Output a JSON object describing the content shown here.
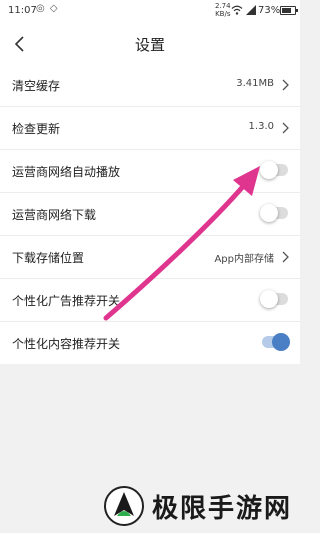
{
  "status_bar": {
    "time": "11:07",
    "net_speed": "2.74",
    "net_unit": "KB/s",
    "battery": "73%",
    "battery_level": 0.73
  },
  "header": {
    "title": "设置"
  },
  "settings": {
    "clear_cache": {
      "label": "清空缓存",
      "value": "3.41MB"
    },
    "check_update": {
      "label": "检查更新",
      "value": "1.3.0"
    },
    "carrier_autoplay": {
      "label": "运营商网络自动播放",
      "enabled": false
    },
    "carrier_download": {
      "label": "运营商网络下载",
      "enabled": false
    },
    "download_location": {
      "label": "下载存储位置",
      "value": "App内部存储"
    },
    "personalized_ads": {
      "label": "个性化广告推荐开关",
      "enabled": false
    },
    "personalized_content": {
      "label": "个性化内容推荐开关",
      "enabled": true
    }
  },
  "watermark": {
    "text": "极限手游网"
  },
  "colors": {
    "toggle_on": "#4a7fc5",
    "toggle_off": "#dcdcdc",
    "arrow": "#e0358f"
  }
}
